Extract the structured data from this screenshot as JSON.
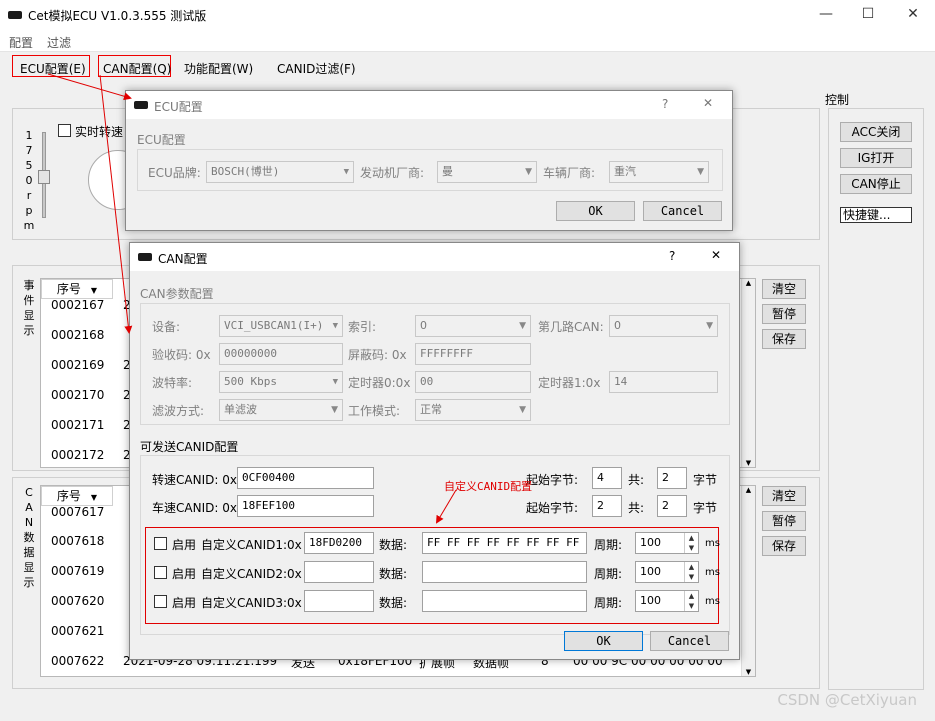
{
  "window": {
    "title": "Cet模拟ECU V1.0.3.555 测试版",
    "minimize": "—",
    "maximize": "☐",
    "close": "✕"
  },
  "menubar": {
    "items": [
      "配置",
      "过滤"
    ]
  },
  "toolbar": {
    "items": [
      "ECU配置(E)",
      "CAN配置(Q)",
      "功能配置(W)",
      "CANID过滤(F)"
    ]
  },
  "control": {
    "title": "控制",
    "buttons": [
      "ACC关闭",
      "IG打开",
      "CAN停止",
      "快捷键..."
    ]
  },
  "speed_panel": {
    "realtime_label": "实时转速",
    "scale": [
      "1",
      "7",
      "5",
      "0",
      "r",
      "p",
      "m"
    ]
  },
  "event_panel": {
    "vlabel": [
      "事",
      "件",
      "显",
      "示"
    ],
    "col_seq": "序号",
    "rows": [
      "0002167",
      "0002168",
      "0002169",
      "0002170",
      "0002171",
      "0002172"
    ],
    "row_prefix": "2",
    "buttons": [
      "清空",
      "暂停",
      "保存"
    ]
  },
  "can_panel": {
    "vlabel": [
      "C",
      "A",
      "N",
      "数",
      "据",
      "显",
      "示"
    ],
    "col_seq": "序号",
    "rows": [
      "0007617",
      "0007618",
      "0007619",
      "0007620",
      "0007621",
      "0007622"
    ],
    "row_prefix": "2",
    "last_row": [
      "2021-09-28 09:11:21.199",
      "发送",
      "0x18FEF100",
      "扩展帧",
      "数据帧",
      "8",
      "00 00 9C 00 00 00 00 00"
    ],
    "buttons": [
      "清空",
      "暂停",
      "保存"
    ]
  },
  "ecu_dialog": {
    "title": "ECU配置",
    "help": "?",
    "close": "✕",
    "group": "ECU配置",
    "brand_label": "ECU品牌:",
    "brand_value": "BOSCH(博世)",
    "engine_label": "发动机厂商:",
    "engine_value": "曼",
    "vehicle_label": "车辆厂商:",
    "vehicle_value": "重汽",
    "ok": "OK",
    "cancel": "Cancel"
  },
  "can_dialog": {
    "title": "CAN配置",
    "help": "?",
    "close": "✕",
    "param_group": "CAN参数配置",
    "device_label": "设备:",
    "device_value": "VCI_USBCAN1(I+)",
    "index_label": "索引:",
    "index_value": "0",
    "channel_label": "第几路CAN:",
    "channel_value": "0",
    "acc_code_label": "验收码: 0x",
    "acc_code_value": "00000000",
    "mask_label": "屏蔽码: 0x",
    "mask_value": "FFFFFFFF",
    "baud_label": "波特率:",
    "baud_value": "500 Kbps",
    "timer0_label": "定时器0:0x",
    "timer0_value": "00",
    "timer1_label": "定时器1:0x",
    "timer1_value": "14",
    "filter_label": "滤波方式:",
    "filter_value": "单滤波",
    "mode_label": "工作模式:",
    "mode_value": "正常",
    "send_group": "可发送CANID配置",
    "rpm_label": "转速CANID: 0x",
    "rpm_value": "0CF00400",
    "speed_label": "车速CANID: 0x",
    "speed_value": "18FEF100",
    "start_byte_label": "起始字节:",
    "rpm_start": "4",
    "rpm_count": "2",
    "speed_start": "2",
    "speed_count": "2",
    "total_label": "共:",
    "byte_label": "字节",
    "annotation": "自定义CANID配置",
    "custom_rows": [
      {
        "enable": "启用",
        "label": "自定义CANID1:0x",
        "id": "18FD0200",
        "data_label": "数据:",
        "data": "FF FF FF FF FF FF FF FF",
        "period_label": "周期:",
        "period": "100",
        "unit": "ms"
      },
      {
        "enable": "启用",
        "label": "自定义CANID2:0x",
        "id": "",
        "data_label": "数据:",
        "data": "",
        "period_label": "周期:",
        "period": "100",
        "unit": "ms"
      },
      {
        "enable": "启用",
        "label": "自定义CANID3:0x",
        "id": "",
        "data_label": "数据:",
        "data": "",
        "period_label": "周期:",
        "period": "100",
        "unit": "ms"
      }
    ],
    "ok": "OK",
    "cancel": "Cancel"
  },
  "watermark": "CSDN @CetXiyuan",
  "colors": {
    "annotation": "#e00000",
    "title_bar": "#ffffff",
    "background": "#f0f0f0"
  }
}
